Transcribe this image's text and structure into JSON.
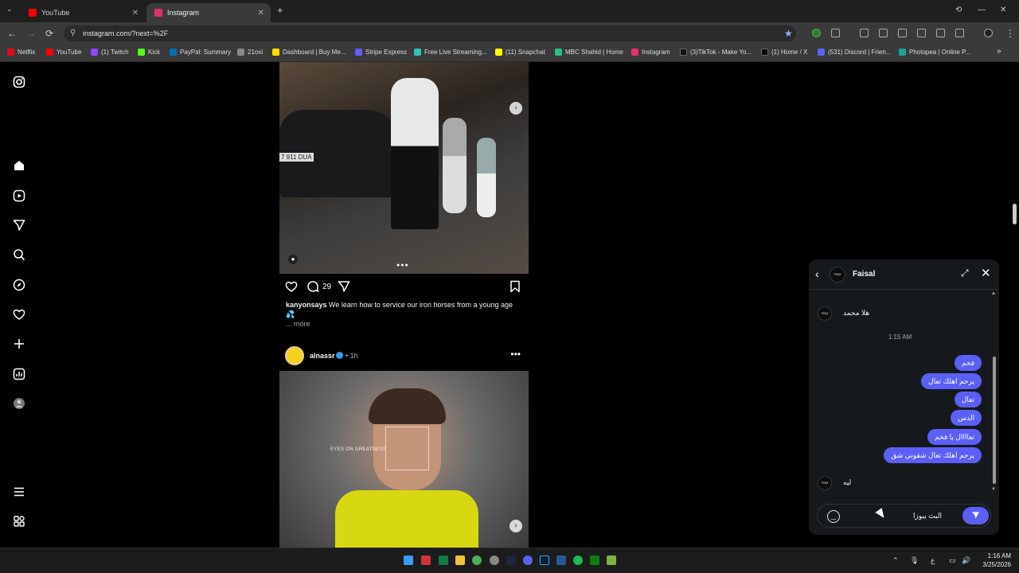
{
  "browser": {
    "tabs": [
      {
        "title": "YouTube",
        "color": "#ff0000"
      },
      {
        "title": "Instagram",
        "color": "#e1306c"
      }
    ],
    "new_tab": "+",
    "url": "instagram.com/?next=%2F",
    "bookmarks": [
      {
        "label": "Netflix",
        "color": "#e50914"
      },
      {
        "label": "YouTube",
        "color": "#ff0000"
      },
      {
        "label": "(1) Twitch",
        "color": "#9146ff"
      },
      {
        "label": "Kick",
        "color": "#53fc18"
      },
      {
        "label": "PayPal: Summary",
        "color": "#0070ba"
      },
      {
        "label": "21oxi",
        "color": "#888888"
      },
      {
        "label": "Dashboard | Buy Me...",
        "color": "#ffdd00"
      },
      {
        "label": "Stripe Express",
        "color": "#635bff"
      },
      {
        "label": "Free Live Streaming...",
        "color": "#2ec4b6"
      },
      {
        "label": "(11) Snapchat",
        "color": "#fffc00"
      },
      {
        "label": "MBC Shahid | Home",
        "color": "#26c281"
      },
      {
        "label": "Instagram",
        "color": "#e1306c"
      },
      {
        "label": "(3)TikTok - Make Yo...",
        "color": "#111111"
      },
      {
        "label": "(1) Home / X",
        "color": "#000000"
      },
      {
        "label": "(531) Discord | Frien...",
        "color": "#5865f2"
      },
      {
        "label": "Photopea | Online P...",
        "color": "#18a497"
      }
    ]
  },
  "post1": {
    "plate": "7 911 DUA",
    "dots": "●●●",
    "comment_count": "29",
    "username": "kanyonsays",
    "caption": "We learn how to service our iron horses from a young age",
    "caption_emoji": "💦",
    "more": "... more"
  },
  "post2": {
    "username": "alnassr",
    "time": "• 1h",
    "overlay_text": "EYES ON GREATNESS"
  },
  "chat": {
    "contact_name": "Faisal",
    "avatar_text": "FBM",
    "incoming_first": "هلا محمد",
    "time": "1:15 AM",
    "outgoing": [
      "فخم",
      "يرحم اهلك تعال",
      "تعال",
      "الدس",
      "تعاااال يا فخم",
      "يرحم اهلك تعال شقوني شق"
    ],
    "incoming_last": "ليه",
    "input_value": "البث يبوزا"
  },
  "taskbar": {
    "time": "1:16 AM",
    "date": "3/25/2026",
    "lang": "ع"
  }
}
